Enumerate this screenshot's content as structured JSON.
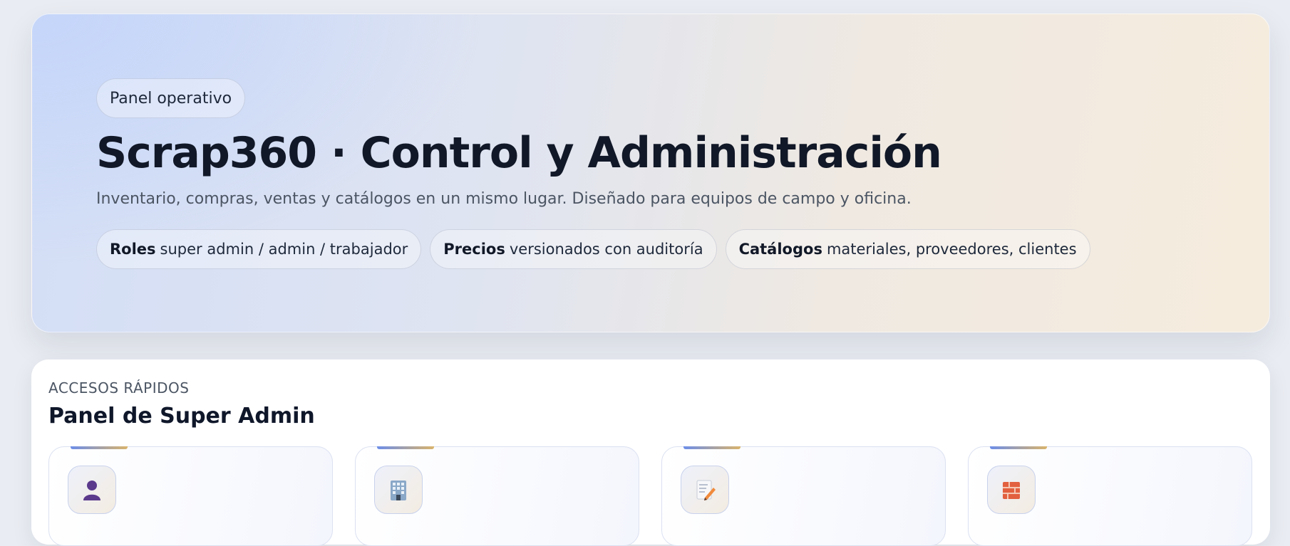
{
  "hero": {
    "tag": "Panel operativo",
    "title": "Scrap360 · Control y Administración",
    "subtitle": "Inventario, compras, ventas y catálogos en un mismo lugar. Diseñado para equipos de campo y oficina.",
    "chips": [
      {
        "label": "Roles",
        "text": "super admin / admin / trabajador"
      },
      {
        "label": "Precios",
        "text": "versionados con auditoría"
      },
      {
        "label": "Catálogos",
        "text": "materiales, proveedores, clientes"
      }
    ]
  },
  "quick_access": {
    "eyebrow": "ACCESOS RÁPIDOS",
    "title": "Panel de Super Admin",
    "cards": [
      {
        "icon": "user-icon"
      },
      {
        "icon": "building-icon"
      },
      {
        "icon": "memo-icon"
      },
      {
        "icon": "brick-icon"
      }
    ]
  },
  "colors": {
    "accent_start": "#6d8ee8",
    "accent_end": "#d9b36c",
    "title": "#111827"
  }
}
